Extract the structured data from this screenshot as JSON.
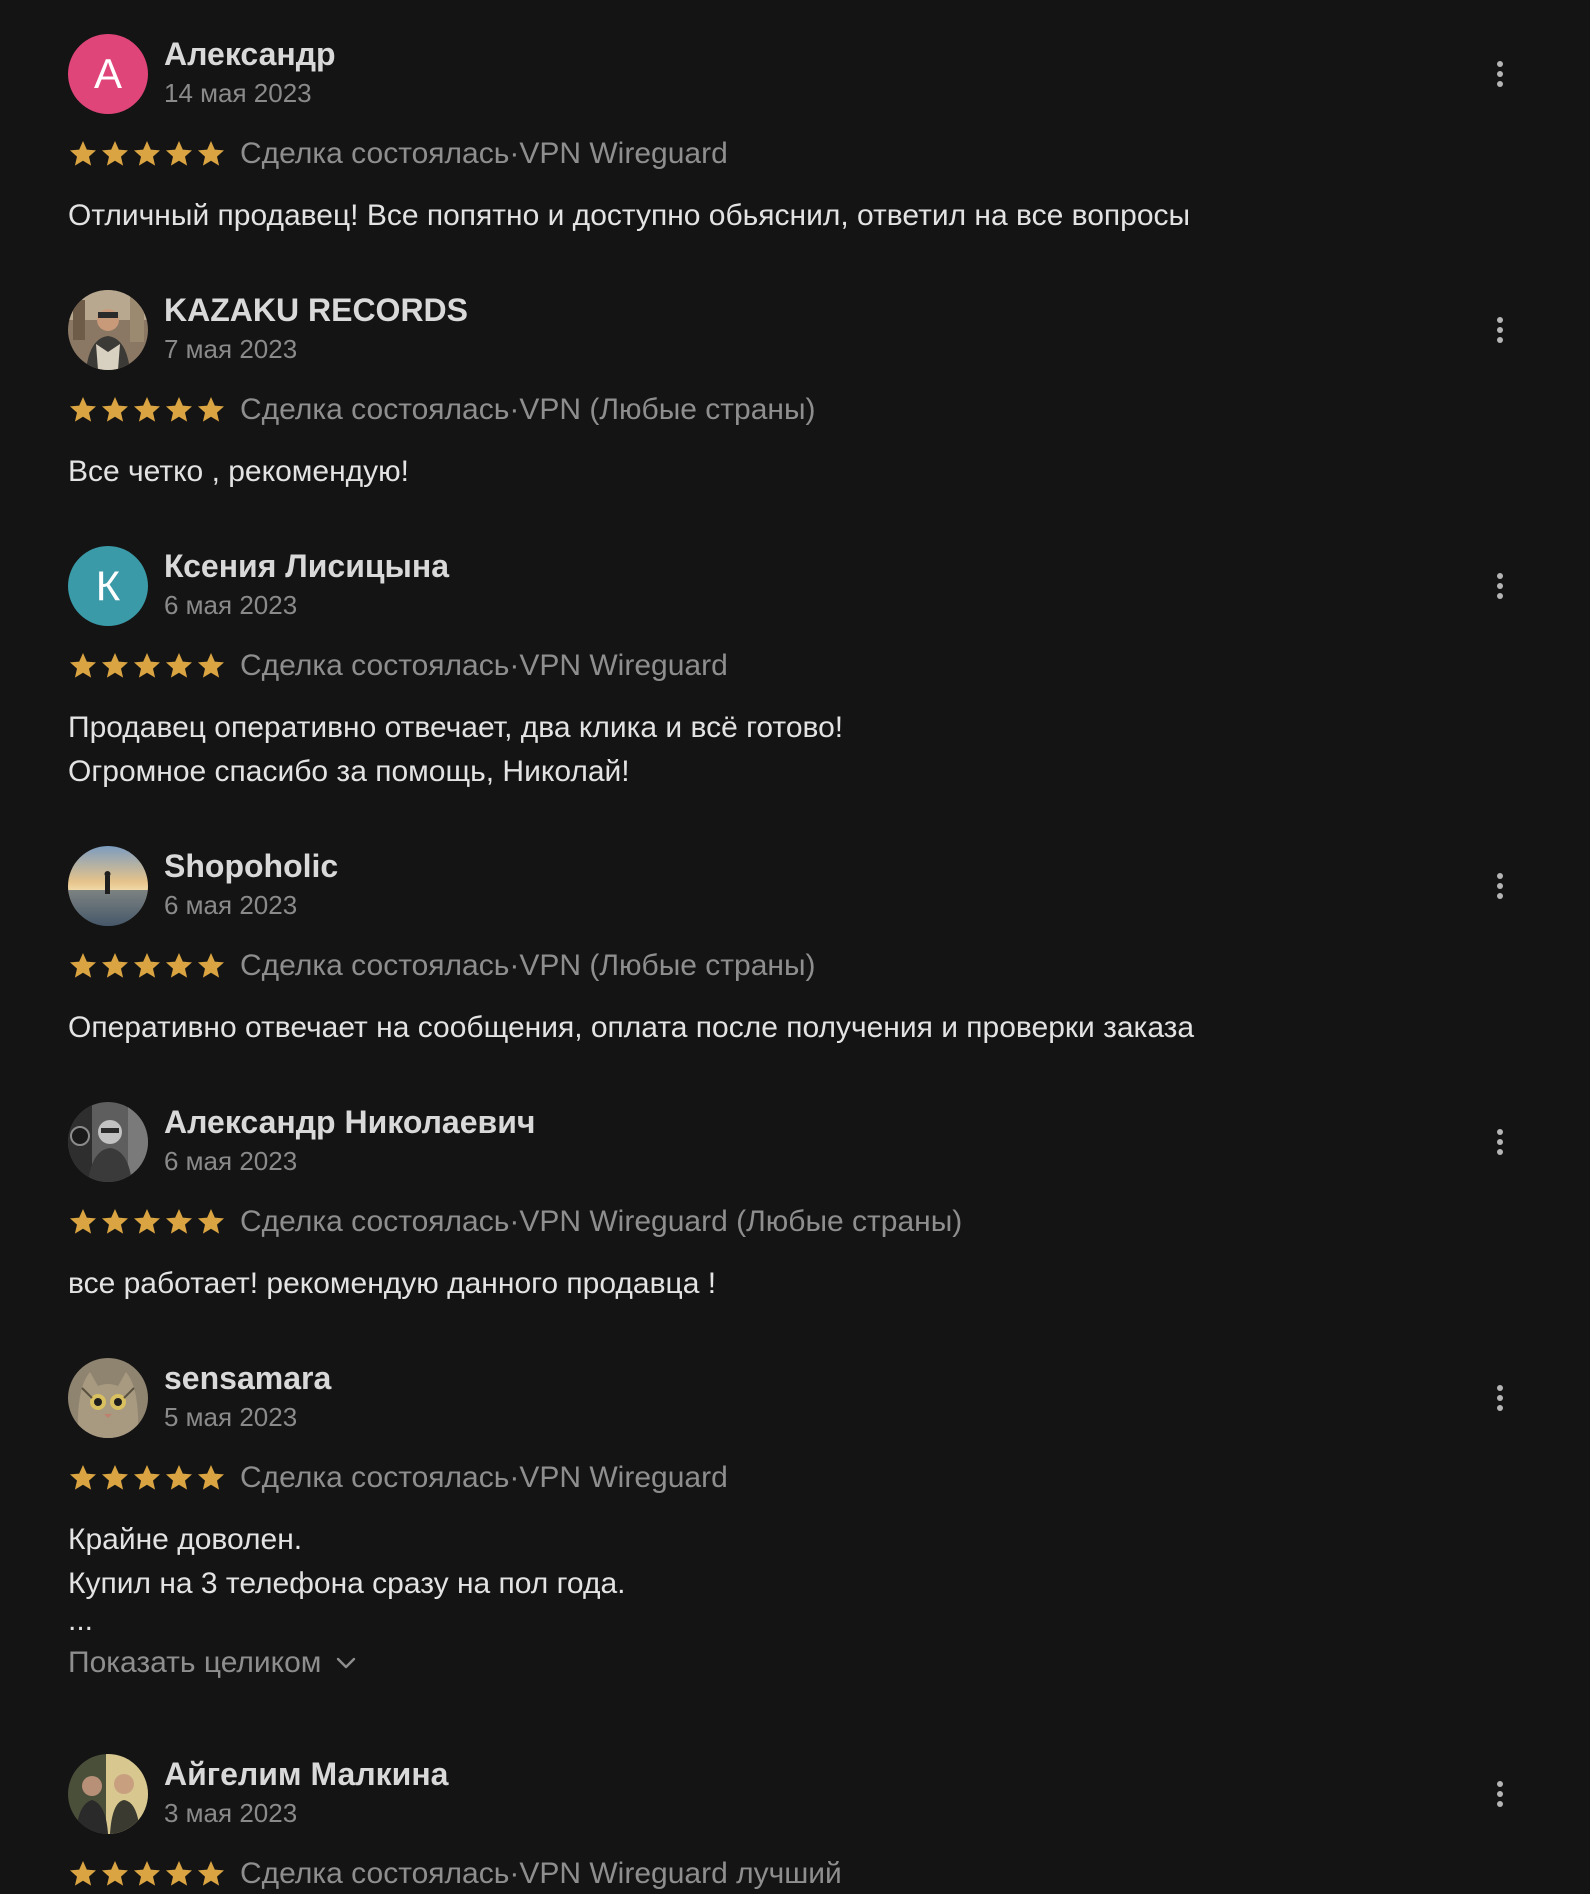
{
  "reviews": [
    {
      "name": "Александр",
      "date": "14 мая 2023",
      "avatar_letter": "А",
      "avatar_color": "#e0457a",
      "rating": 5,
      "status": "Сделка состоялась",
      "product": "VPN Wireguard",
      "text": [
        "Отличный продавец! Все попятно и доступно обьяснил, ответил на все вопросы"
      ]
    },
    {
      "name": "KAZAKU RECORDS",
      "date": "7 мая 2023",
      "avatar_letter": "",
      "avatar_color": "#6b5a4a",
      "rating": 5,
      "status": "Сделка состоялась",
      "product": "VPN (Любые страны)",
      "text": [
        "Все четко , рекомендую!"
      ]
    },
    {
      "name": "Ксения Лисицына",
      "date": "6 мая 2023",
      "avatar_letter": "К",
      "avatar_color": "#3a9aa8",
      "rating": 5,
      "status": "Сделка состоялась",
      "product": "VPN Wireguard",
      "text": [
        "Продавец оперативно отвечает, два клика и всё готово!",
        "Огромное спасибо за помощь, Николай!"
      ]
    },
    {
      "name": "Shopoholic",
      "date": "6 мая 2023",
      "avatar_letter": "",
      "avatar_color": "#6f8aa6",
      "rating": 5,
      "status": "Сделка состоялась",
      "product": "VPN (Любые страны)",
      "text": [
        "Оперативно отвечает на сообщения, оплата после получения и проверки заказа"
      ]
    },
    {
      "name": "Александр Николаевич",
      "date": "6 мая 2023",
      "avatar_letter": "",
      "avatar_color": "#5a5a5a",
      "rating": 5,
      "status": "Сделка состоялась",
      "product": "VPN Wireguard (Любые страны)",
      "text": [
        "все работает! рекомендую данного продавца !"
      ]
    },
    {
      "name": "sensamara",
      "date": "5 мая 2023",
      "avatar_letter": "",
      "avatar_color": "#8a7a5e",
      "rating": 5,
      "status": "Сделка состоялась",
      "product": "VPN Wireguard",
      "text": [
        "Крайне доволен.",
        "Купил на 3 телефона сразу на пол года."
      ],
      "ellipsis": "...",
      "show_more": "Показать целиком"
    },
    {
      "name": "Айгелим Малкина",
      "date": "3 мая 2023",
      "avatar_letter": "",
      "avatar_color": "#4a4f3a",
      "rating": 5,
      "status": "Сделка состоялась",
      "product": "VPN Wireguard лучший",
      "text": []
    }
  ],
  "separator": " · ",
  "colors": {
    "background": "#141414",
    "star": "#d9a441",
    "name": "#d9d9d9",
    "muted": "#8e8e8e"
  },
  "icons": {
    "more": "more-vertical-icon",
    "star": "star-icon",
    "chevron": "chevron-down-icon"
  }
}
